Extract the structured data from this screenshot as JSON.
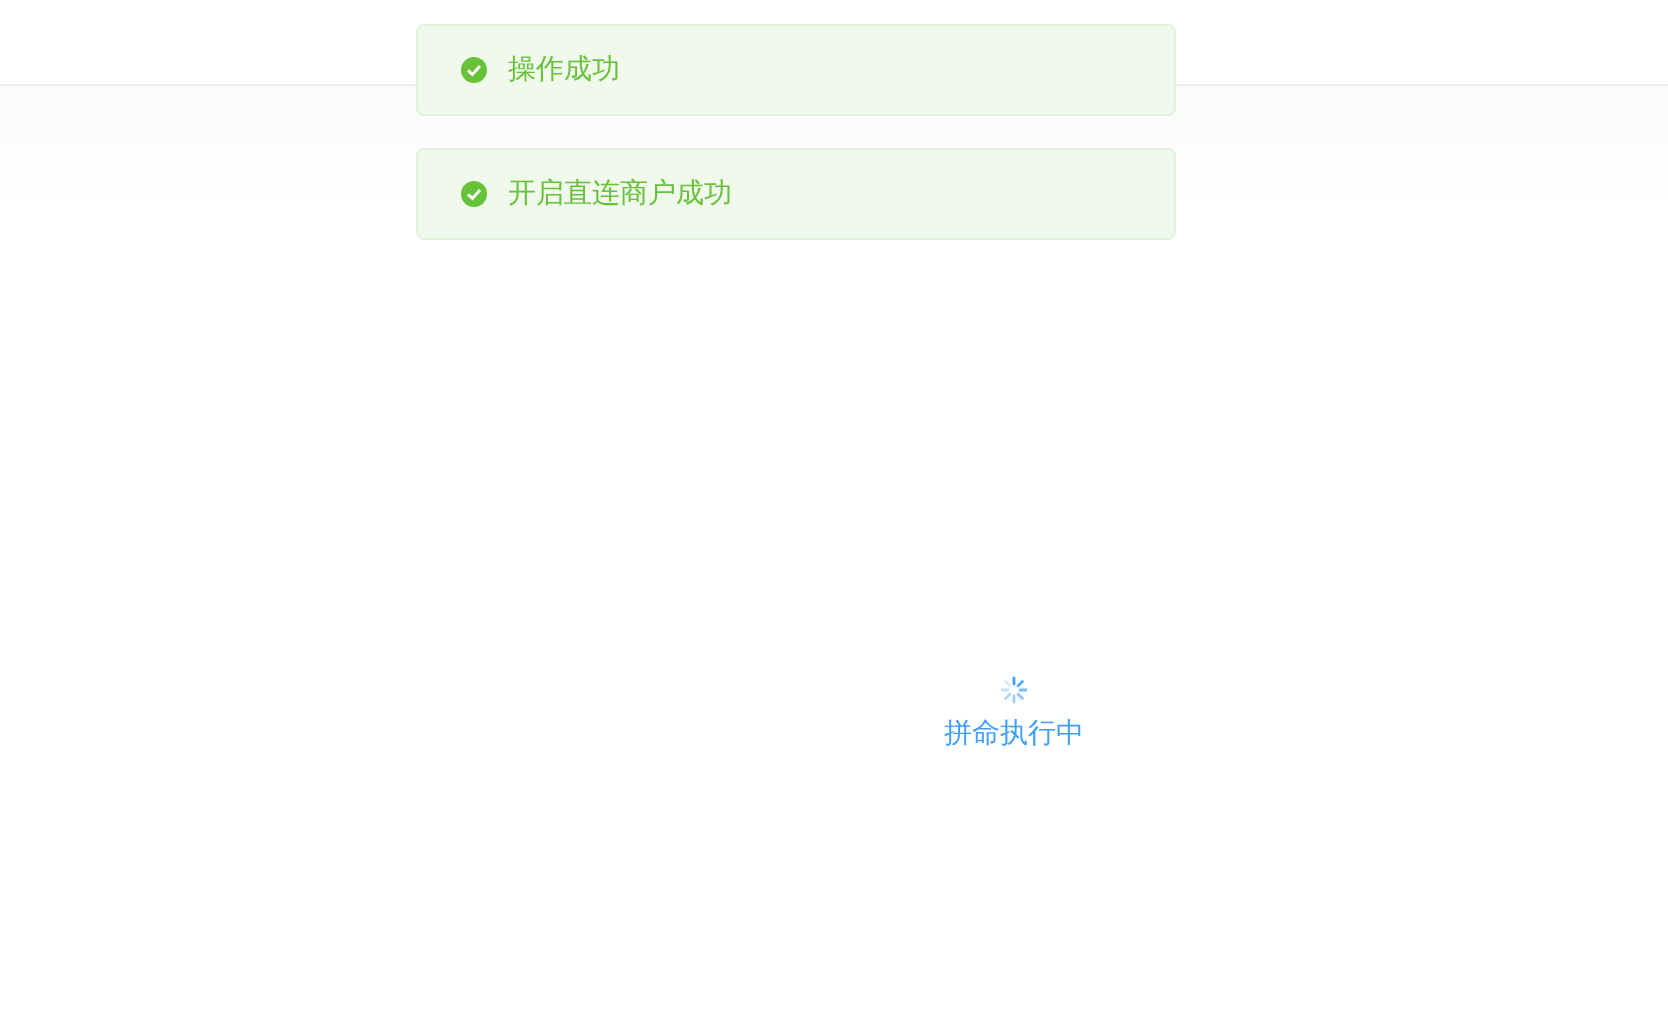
{
  "messages": [
    {
      "kind": "success",
      "text": "操作成功"
    },
    {
      "kind": "success",
      "text": "开启直连商户成功"
    }
  ],
  "loading": {
    "text": "拼命执行中"
  }
}
